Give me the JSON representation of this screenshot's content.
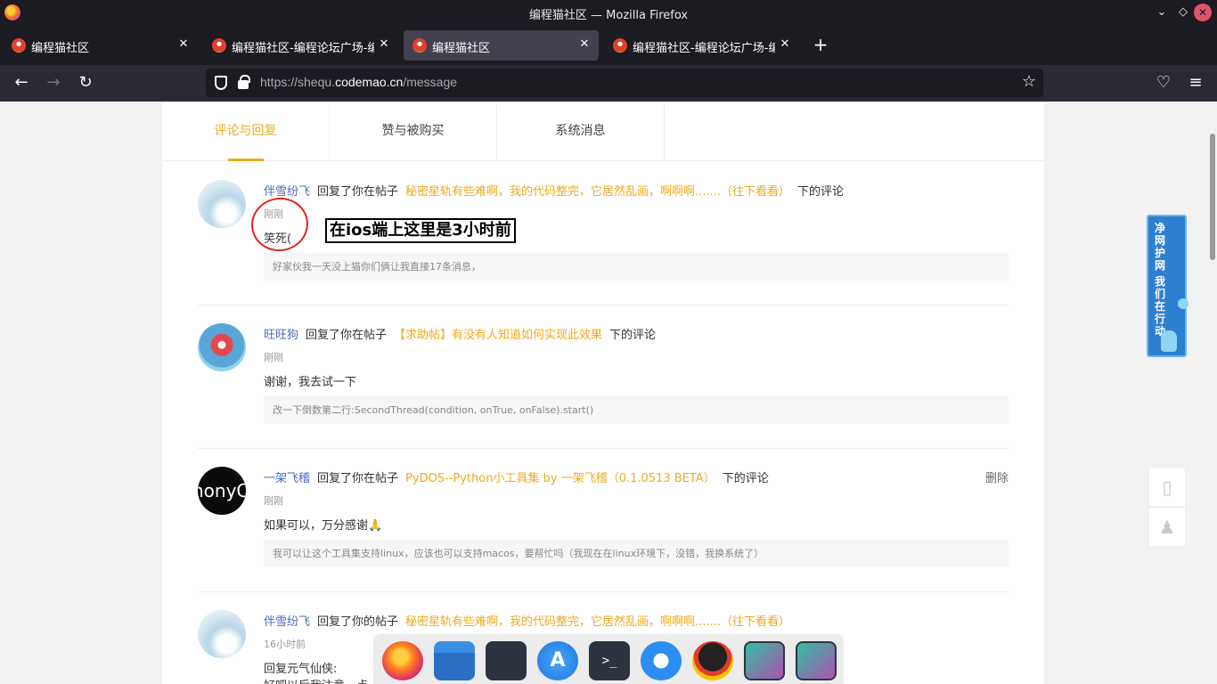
{
  "window": {
    "title": "编程猫社区 — Mozilla Firefox",
    "controls": [
      "chevron-down",
      "restore",
      "close"
    ]
  },
  "tabs": [
    {
      "label": "编程猫社区",
      "active": false
    },
    {
      "label": "编程猫社区-编程论坛广场-编",
      "active": false
    },
    {
      "label": "编程猫社区",
      "active": true
    },
    {
      "label": "编程猫社区-编程论坛广场-编",
      "active": false
    }
  ],
  "nav": {
    "url_prefix": "https://shequ.",
    "url_domain": "codemao.cn",
    "url_path": "/message"
  },
  "page_tabs": [
    {
      "label": "评论与回复",
      "active": true
    },
    {
      "label": "赞与被购买",
      "active": false
    },
    {
      "label": "系统消息",
      "active": false
    }
  ],
  "messages": [
    {
      "user": "伴雪纷飞",
      "action": "回复了你在帖子",
      "post": "秘密星轨有些难啊，我的代码整完，它居然乱画，啊啊啊.......（往下看看）",
      "suffix": "下的评论",
      "time": "刚刚",
      "content": "笑死(",
      "quote": "好家伙我一天没上猫你们俩让我直接17条消息，"
    },
    {
      "user": "旺旺狗",
      "action": "回复了你在帖子",
      "post": "【求助帖】有没有人知道如何实现此效果",
      "suffix": "下的评论",
      "time": "刚刚",
      "content": "谢谢，我去试一下",
      "quote": "改一下倒数第二行:SecondThread(condition, onTrue, onFalse).start()"
    },
    {
      "user": "一架飞稽",
      "action": "回复了你在帖子",
      "post": "PyDOS--Python小工具集 by 一架飞稽（0.1.0513 BETA）",
      "suffix": "下的评论",
      "time": "刚刚",
      "content": "如果可以，万分感谢🙏",
      "quote": "我可以让这个工具集支持linux，应该也可以支持macos，要帮忙吗（我现在在linux环境下，没错，我换系统了）",
      "delete_label": "删除",
      "avatar_text": "honyC"
    },
    {
      "user": "伴雪纷飞",
      "action": "回复了你的帖子",
      "post": "秘密星轨有些难啊，我的代码整完，它居然乱画，啊啊啊.......（往下看看）",
      "suffix": "",
      "time": "16小时前",
      "content": "回复元气仙侠:",
      "content2": "好吧以后我注意一点"
    }
  ],
  "annotation": {
    "text": "在ios端上这里是3小时前",
    "circle_color": "#e2231a"
  },
  "side_banner": {
    "text_a": "净网护网",
    "text_b": "我们在行动"
  },
  "colors": {
    "accent": "#f0a91c",
    "username": "#4a6ab8",
    "titlebar": "#1c1b22",
    "navbar": "#2b2a33"
  },
  "dock": [
    "firefox-icon",
    "files-icon",
    "settings-icon",
    "app-store-icon",
    "terminal-icon",
    "kite-icon",
    "qq-icon",
    "screenshot-icon",
    "screenshot-icon"
  ]
}
